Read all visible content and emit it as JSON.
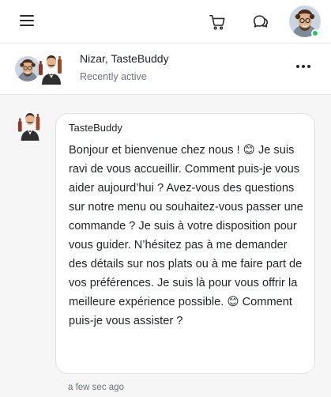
{
  "topbar": {
    "menu_icon": "hamburger-menu-icon",
    "cart_icon": "cart-icon",
    "chat_icon": "chat-bubbles-icon",
    "user_status_color": "#22c55e"
  },
  "conversation": {
    "title": "Nizar, TasteBuddy",
    "status": "Recently active",
    "more_icon": "more-dots-icon"
  },
  "messages": [
    {
      "sender": "TasteBuddy",
      "text": "Bonjour et bienvenue chez nous ! 😊 Je suis ravi de vous accueillir. Comment puis-je vous aider aujourd’hui ? Avez-vous des questions sur notre menu ou souhaitez-vous passer une commande ? Je suis à votre disposition pour vous guider. N’hésitez pas à me demander des détails sur nos plats ou à me faire part de vos préférences. Je suis là pour vous offrir la meilleure expérience possible. 😊 Comment puis-je vous assister ?",
      "time": "a few sec ago"
    }
  ]
}
